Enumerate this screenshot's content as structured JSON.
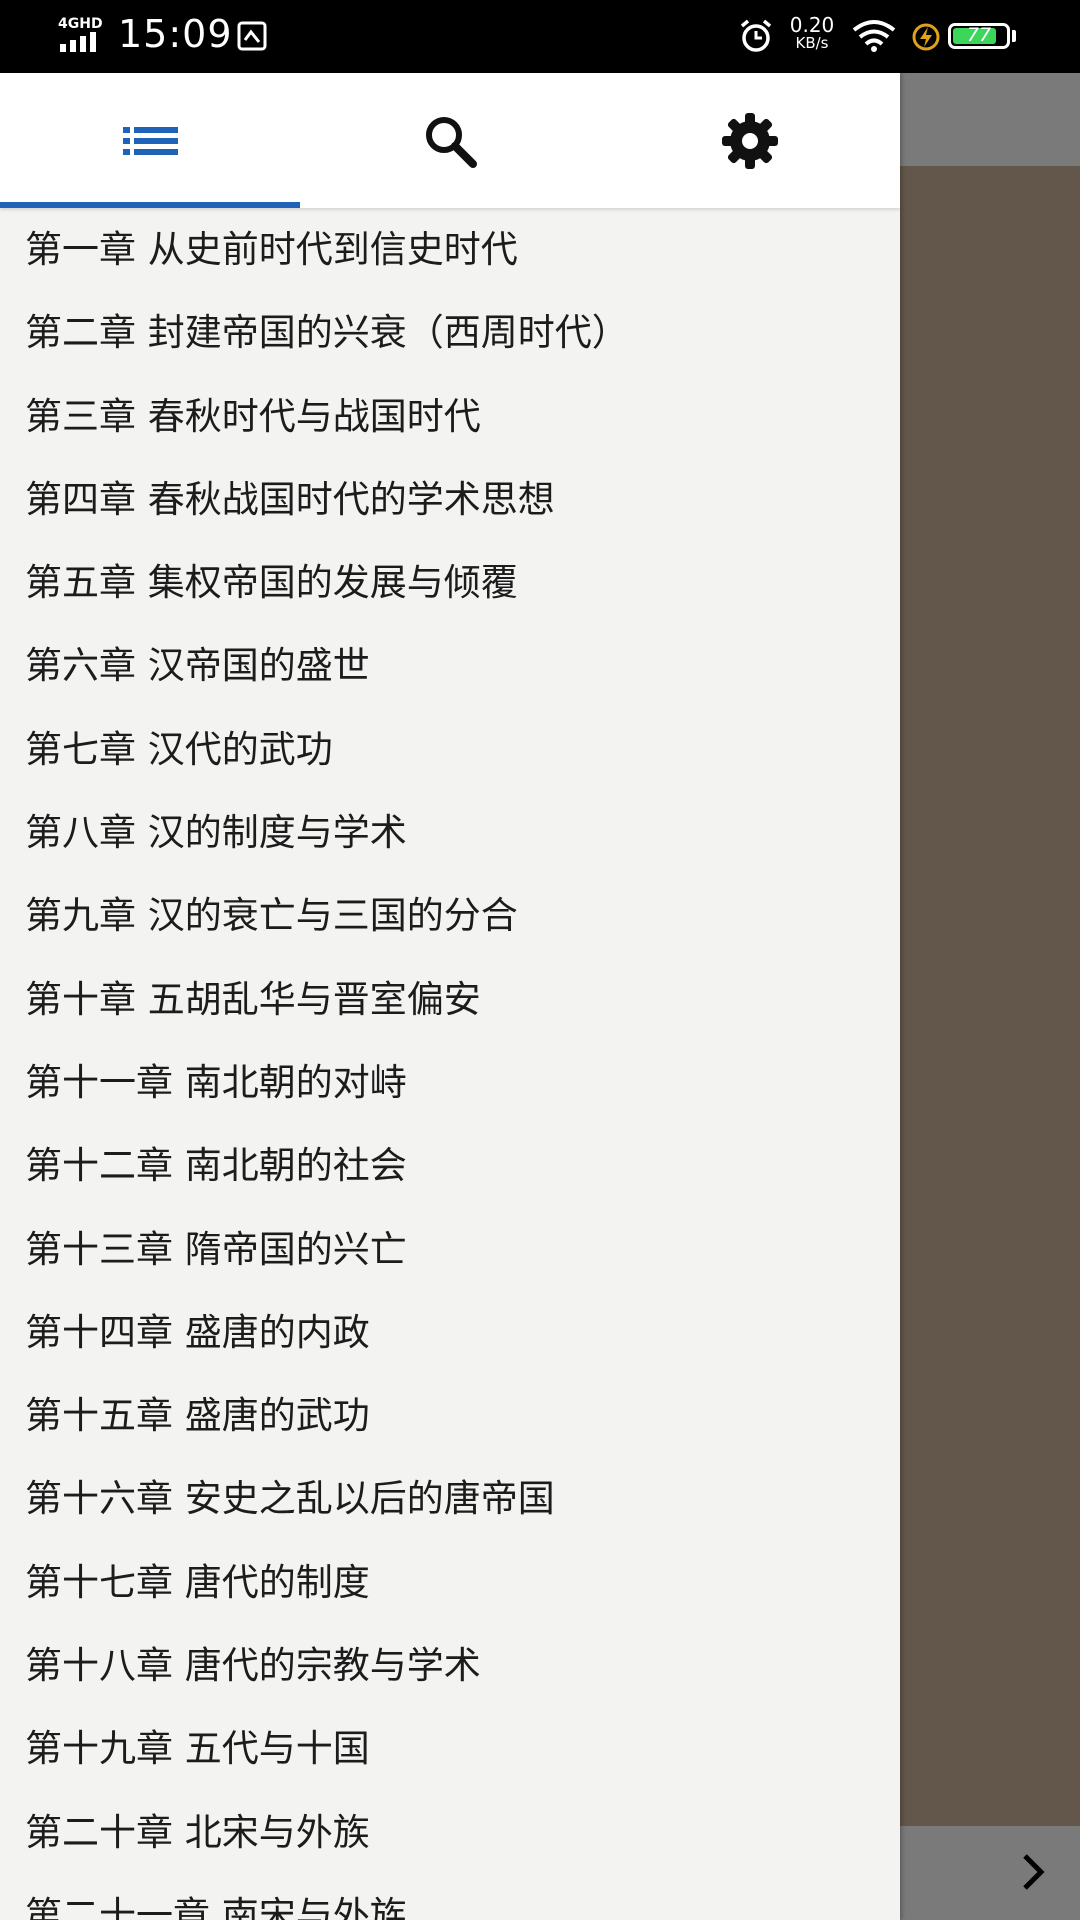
{
  "status_bar": {
    "network": "4GHD",
    "time": "15:09",
    "speed_value": "0.20",
    "speed_unit": "KB/s",
    "battery": "77"
  },
  "drawer": {
    "tabs": [
      {
        "name": "tab-contents",
        "icon": "list-icon"
      },
      {
        "name": "tab-search",
        "icon": "search-icon"
      },
      {
        "name": "tab-settings",
        "icon": "gear-icon"
      }
    ],
    "active_tab": "tab-contents",
    "accent_color": "#1e63b8",
    "chapters": [
      "第一章 从史前时代到信史时代",
      "第二章 封建帝国的兴衰（西周时代）",
      "第三章 春秋时代与战国时代",
      "第四章 春秋战国时代的学术思想",
      "第五章 集权帝国的发展与倾覆",
      "第六章 汉帝国的盛世",
      "第七章 汉代的武功",
      "第八章 汉的制度与学术",
      "第九章 汉的衰亡与三国的分合",
      "第十章 五胡乱华与晋室偏安",
      "第十一章 南北朝的对峙",
      "第十二章 南北朝的社会",
      "第十三章 隋帝国的兴亡",
      "第十四章 盛唐的内政",
      "第十五章 盛唐的武功",
      "第十六章 安史之乱以后的唐帝国",
      "第十七章 唐代的制度",
      "第十八章 唐代的宗教与学术",
      "第十九章 五代与十国",
      "第二十章 北宋与外族",
      "第二十一章 南宋与外族"
    ]
  },
  "background": {
    "next_icon": "chevron-right-icon"
  }
}
